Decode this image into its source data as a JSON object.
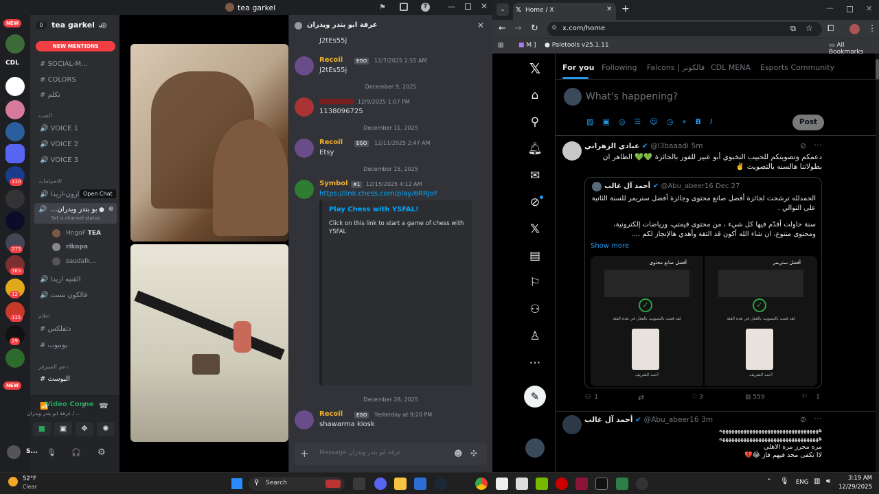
{
  "discord": {
    "window_title": "tea garkel",
    "servers": {
      "new_top": "NEW",
      "new_bottom": "NEW",
      "labels": [
        "CDL"
      ],
      "badges": [
        "110",
        "275",
        "1K+",
        "12",
        "115",
        "29"
      ]
    },
    "server_name": "tea garkel",
    "server_count": "0",
    "new_mentions": "NEW MENTIONS",
    "channels": [
      "SOCIAL-M...",
      "COLORS",
      "تكلم"
    ],
    "cat_1": "الصب",
    "voice": [
      "VOICE 1",
      "VOICE 2",
      "VOICE 3"
    ],
    "cat_2": "الاحتياجات",
    "ch_arab1": "ان‌ارون-اريدا",
    "tooltip": "Open Chat",
    "active_voice": "...بو بتدر ويدران",
    "set_status": "Set a channel status",
    "members": [
      {
        "name": "HngoF",
        "tag": "TEA"
      },
      {
        "name": "rikopa",
        "tag": ""
      },
      {
        "name": "saudalk...",
        "tag": ""
      }
    ],
    "ch_arab2": "القنيه اريدا",
    "ch_arab3": "فالكون نست",
    "cat_3": "اعلام",
    "ch_arab4": "دتفلكس",
    "ch_arab5": "يوتيوب",
    "cat_4": "دعم السيرفر",
    "ch_arab6": "البوست",
    "voice_connected": "Video Connected",
    "voice_sub": "عرفة ابو بتدر ويدران / ...",
    "user_name": "S...",
    "chat": {
      "title": "عرفة ابو بتدر ويدران",
      "top_text": "J2tEs55j",
      "messages": [
        {
          "author": "Recoil",
          "tag": "EGO",
          "time": "12/7/2025 2:55 AM",
          "text": "J2tEs55j"
        },
        {
          "date": "December 9, 2025"
        },
        {
          "author": "",
          "tag": "",
          "time": "12/9/2025 1:07 PM",
          "text": "1138096725"
        },
        {
          "date": "December 11, 2025"
        },
        {
          "author": "Recoil",
          "tag": "EGO",
          "time": "12/11/2025 2:47 AM",
          "text": "Etsy"
        },
        {
          "date": "December 15, 2025"
        },
        {
          "author": "Symbol",
          "tag": "#1",
          "time": "12/15/2025 4:12 AM",
          "text": "https://link.chess.com/play/6RRJoF"
        },
        {
          "date": "December 28, 2025"
        },
        {
          "author": "Recoil",
          "tag": "EGO",
          "time": "Yesterday at 9:20 PM",
          "text": "shawarma kiosk"
        }
      ],
      "embed_title": "Play Chess with YSFAL!",
      "embed_desc": "Click on this link to start a game of chess with YSFAL",
      "placeholder": "Message عرفة ابو بتدر ويدران"
    }
  },
  "chrome": {
    "tab_title": "Home / X",
    "url": "x.com/home",
    "bookmarks": [
      "M ]",
      "Paletools v25.1.11"
    ],
    "all_bookmarks": "All Bookmarks"
  },
  "x": {
    "tabs": [
      "For you",
      "Following",
      "Falcons | فالكونز",
      "CDL MENA",
      "Esports Community"
    ],
    "compose_placeholder": "What's happening?",
    "post_button": "Post",
    "tweets": [
      {
        "name": "عبادي الزهراني",
        "handle": "@l3baaadi",
        "time": "5m",
        "text": "دعمكم وتصويتكم للحبيب النخبوي أبو عبير للفوز بالجائزة 💚💚 الظاهر ان بطولاتنا هالسنه بالتصويت ✌️",
        "quote": {
          "name": "أحمد آل غالب",
          "handle": "@Abu_abeer16",
          "time": "Dec 27",
          "text1": "الحمدلله ترشحت لجائزة أفضل صانع محتوى وجائزة أفضل ستريمر للسنة الثانية على التوالي .",
          "text2": "سنة حاولت أقدّم فيها كل شيء ، من محتوى قيمتي، ورياضات إلكترونية، ومحتوى متنوع، ان شاء الله أكون قد الثقة وأهدي هالإنجاز لكم ....",
          "show_more": "Show more",
          "card1_title": "أفضل صانع محتوى",
          "card2_title": "أفضل ستريمر",
          "card_caption": "لقد قمت بالتصويت بالفعل في هذه الفئة",
          "card_person": "أحمد الشريف"
        },
        "stats": {
          "replies": "1",
          "likes": "3",
          "views": "559"
        }
      },
      {
        "name": "أحمد آل غالب",
        "handle": "@Abu_abeer16",
        "time": "3m",
        "lines": [
          "هههههههههههههههههههههههههههههههههه",
          "هههههههههههههههههههههههههههههههههه",
          "مره محرز مره الاهلي",
          "لاا تكفى محد فيهم فاز 😂💔"
        ]
      }
    ]
  },
  "taskbar": {
    "temp": "52°F",
    "weather": "Clear",
    "search": "Search",
    "lang": "ENG",
    "time": "3:19 AM",
    "date": "12/29/2025"
  },
  "colors": {
    "discord_bg": "#313338",
    "accent": "#5865f2",
    "green": "#23a55a",
    "x_blue": "#1d9bf0",
    "red": "#f23f43"
  }
}
